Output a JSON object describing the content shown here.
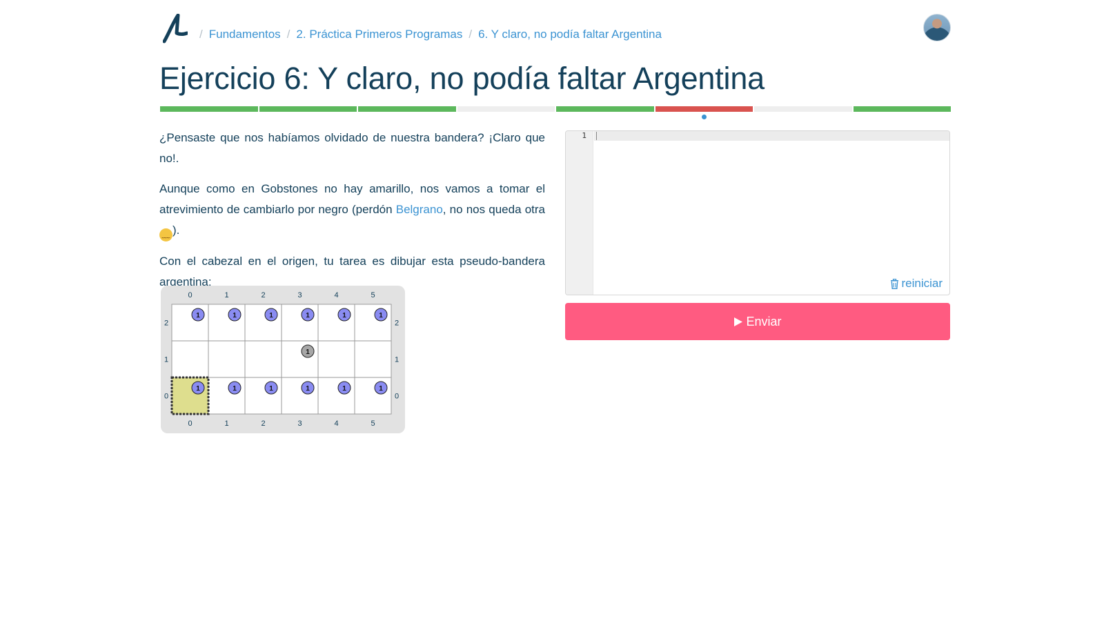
{
  "breadcrumb": {
    "logo": "mumuki-logo",
    "separator": "/",
    "items": [
      "Fundamentos",
      "2. Práctica Primeros Programas",
      "6. Y claro, no podía faltar Argentina"
    ]
  },
  "title": "Ejercicio 6: Y claro, no podía faltar Argentina",
  "progress": {
    "segments": [
      "passed",
      "passed",
      "passed",
      "pending",
      "passed",
      "failed",
      "pending",
      "passed"
    ],
    "current_index": 5,
    "colors": {
      "passed": "#5cb85c",
      "failed": "#d9534f",
      "pending": "#eeeeee",
      "current": "#3b93d2"
    }
  },
  "description": {
    "p1": "¿Pensaste que nos habíamos olvidado de nuestra bandera? ¡Claro que no!.",
    "p2_before": "Aunque como en Gobstones no hay amarillo, nos vamos a tomar el atrevimiento de cambiarlo por negro (perdón ",
    "p2_link": "Belgrano",
    "p2_after": ", no nos queda otra ",
    "p2_emoji": "crying-face-icon",
    "p2_end": ").",
    "p3": "Con el cabezal en el origen, tu tarea es dibujar esta pseudo-bandera argentina:"
  },
  "board": {
    "columns": [
      "0",
      "1",
      "2",
      "3",
      "4",
      "5"
    ],
    "rows": [
      "2",
      "1",
      "0"
    ],
    "head": {
      "x": 0,
      "y": 0
    },
    "stones": [
      {
        "x": 0,
        "y": 2,
        "color": "blue",
        "count": "1"
      },
      {
        "x": 1,
        "y": 2,
        "color": "blue",
        "count": "1"
      },
      {
        "x": 2,
        "y": 2,
        "color": "blue",
        "count": "1"
      },
      {
        "x": 3,
        "y": 2,
        "color": "blue",
        "count": "1"
      },
      {
        "x": 4,
        "y": 2,
        "color": "blue",
        "count": "1"
      },
      {
        "x": 5,
        "y": 2,
        "color": "blue",
        "count": "1"
      },
      {
        "x": 3,
        "y": 1,
        "color": "black",
        "count": "1"
      },
      {
        "x": 0,
        "y": 0,
        "color": "blue",
        "count": "1"
      },
      {
        "x": 1,
        "y": 0,
        "color": "blue",
        "count": "1"
      },
      {
        "x": 2,
        "y": 0,
        "color": "blue",
        "count": "1"
      },
      {
        "x": 3,
        "y": 0,
        "color": "blue",
        "count": "1"
      },
      {
        "x": 4,
        "y": 0,
        "color": "blue",
        "count": "1"
      },
      {
        "x": 5,
        "y": 0,
        "color": "blue",
        "count": "1"
      }
    ],
    "colors": {
      "blue": "#8a8cf2",
      "black": "#a7a7a7",
      "head_fill": "#dede8e"
    }
  },
  "editor": {
    "line_numbers": [
      "1"
    ],
    "code": "",
    "reset_label": "reiniciar",
    "reset_icon": "trash-icon"
  },
  "submit": {
    "label": "Enviar",
    "icon": "play-icon"
  }
}
